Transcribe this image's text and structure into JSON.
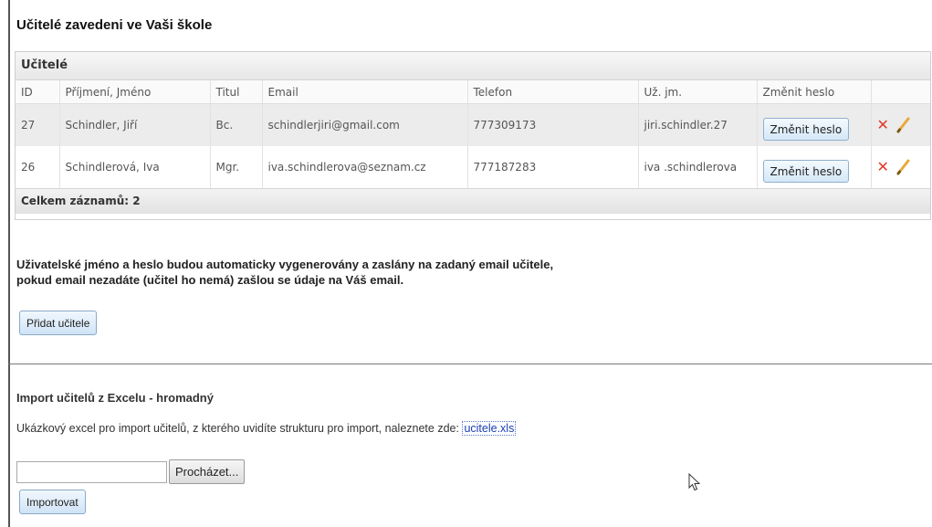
{
  "page": {
    "title": "Učitelé zavedeni ve Vaši škole"
  },
  "teachers_panel": {
    "header": "Učitelé",
    "columns": [
      "ID",
      "Příjmení, Jméno",
      "Titul",
      "Email",
      "Telefon",
      "Už. jm.",
      "Změnit heslo",
      ""
    ],
    "rows": [
      {
        "id": "27",
        "name": "Schindler, Jiří",
        "title": "Bc.",
        "email": "schindlerjiri@gmail.com",
        "phone": "777309173",
        "username": "jiri.schindler.27",
        "change_label": "Změnit heslo"
      },
      {
        "id": "26",
        "name": "Schindlerová, Iva",
        "title": "Mgr.",
        "email": "iva.schindlerova@seznam.cz",
        "phone": "777187283",
        "username": "iva .schindlerova",
        "change_label": "Změnit heslo"
      }
    ],
    "footer": "Celkem záznamů: 2"
  },
  "info_text": {
    "line1": "Uživatelské jméno a heslo budou automaticky vygenerovány a zaslány na zadaný email učitele,",
    "line2": "pokud email nezadáte (učitel ho nemá) zašlou se údaje na Váš email."
  },
  "add_button": {
    "label": "Přidat učitele"
  },
  "import": {
    "title": "Import učitelů z Excelu - hromadný",
    "description": "Ukázkový excel pro import učitelů, z kterého uvidíte strukturu pro import, naleznete zde:",
    "link_text": "ucitele.xls",
    "browse_label": "Procházet...",
    "import_label": "Importovat"
  },
  "icons": {
    "delete": "delete-x-icon",
    "edit": "pencil-edit-icon"
  },
  "colors": {
    "delete_icon": "#e03a2a",
    "edit_icon": "#e8a93a",
    "link": "#1a3fb0"
  }
}
